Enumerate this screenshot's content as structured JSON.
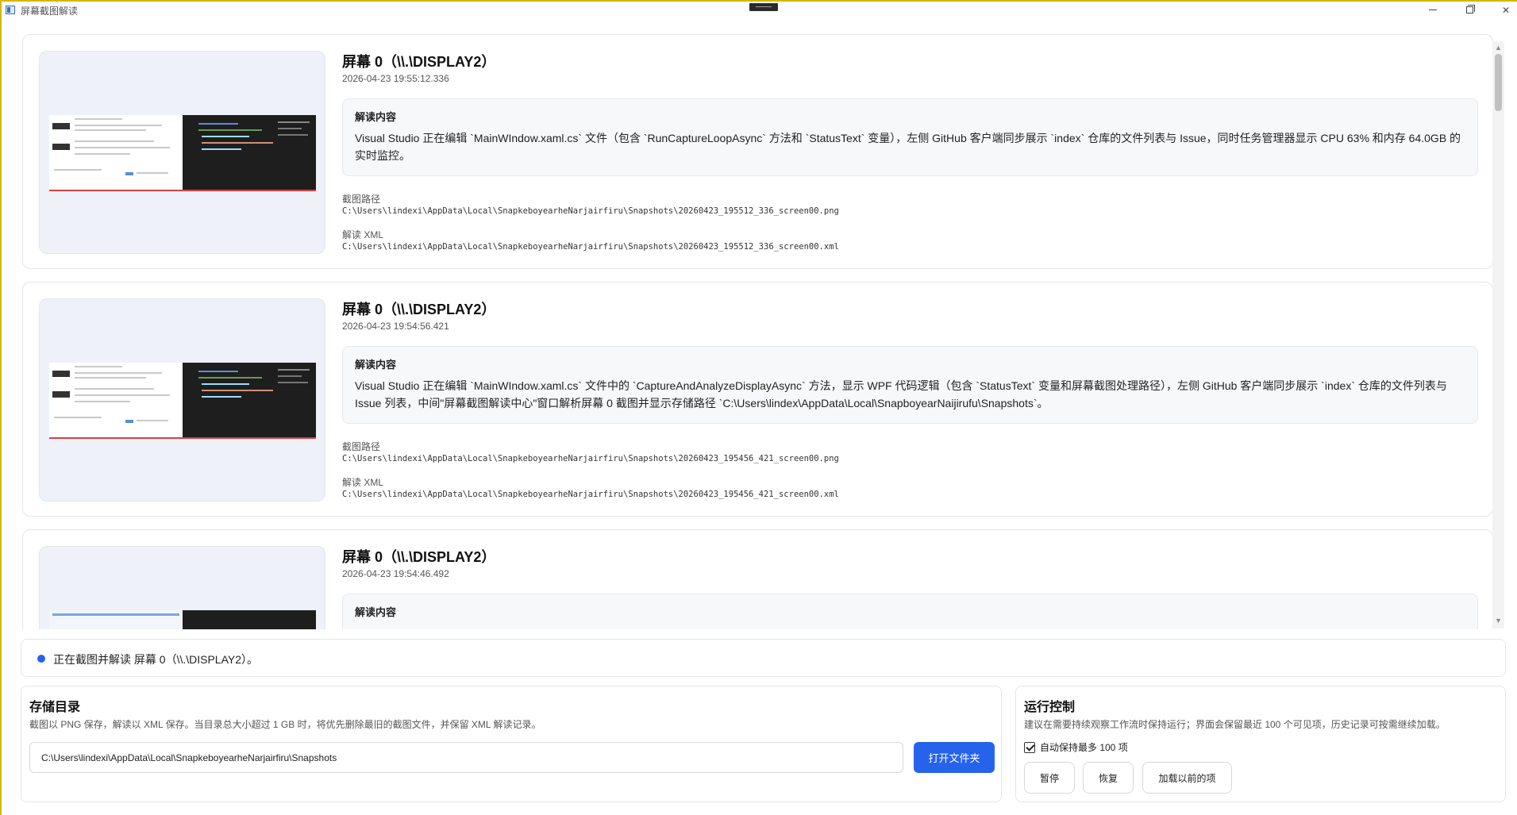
{
  "window": {
    "title": "屏幕截图解读"
  },
  "entries": [
    {
      "title": "屏幕 0（\\\\.\\DISPLAY2）",
      "timestamp": "2026-04-23 19:55:12.336",
      "analysis_label": "解读内容",
      "analysis_text": "Visual Studio 正在编辑 `MainWIndow.xaml.cs` 文件（包含 `RunCaptureLoopAsync` 方法和 `StatusText` 变量），左侧 GitHub 客户端同步展示 `index` 仓库的文件列表与 Issue，同时任务管理器显示 CPU 63% 和内存 64.0GB 的实时监控。",
      "screenshot_path_label": "截图路径",
      "screenshot_path": "C:\\Users\\lindexi\\AppData\\Local\\SnapkeboyearheNarjairfiru\\Snapshots\\20260423_195512_336_screen00.png",
      "xml_path_label": "解读 XML",
      "xml_path": "C:\\Users\\lindexi\\AppData\\Local\\SnapkeboyearheNarjairfiru\\Snapshots\\20260423_195512_336_screen00.xml"
    },
    {
      "title": "屏幕 0（\\\\.\\DISPLAY2）",
      "timestamp": "2026-04-23 19:54:56.421",
      "analysis_label": "解读内容",
      "analysis_text": "Visual Studio 正在编辑 `MainWIndow.xaml.cs` 文件中的 `CaptureAndAnalyzeDisplayAsync` 方法，显示 WPF 代码逻辑（包含 `StatusText` 变量和屏幕截图处理路径），左侧 GitHub 客户端同步展示 `index` 仓库的文件列表与 Issue 列表，中间\"屏幕截图解读中心\"窗口解析屏幕 0 截图并显示存储路径 `C:\\Users\\lindex\\AppData\\Local\\SnapboyearNaijirufu\\Snapshots`。",
      "screenshot_path_label": "截图路径",
      "screenshot_path": "C:\\Users\\lindexi\\AppData\\Local\\SnapkeboyearheNarjairfiru\\Snapshots\\20260423_195456_421_screen00.png",
      "xml_path_label": "解读 XML",
      "xml_path": "C:\\Users\\lindexi\\AppData\\Local\\SnapkeboyearheNarjairfiru\\Snapshots\\20260423_195456_421_screen00.xml"
    },
    {
      "title": "屏幕 0（\\\\.\\DISPLAY2）",
      "timestamp": "2026-04-23 19:54:46.492",
      "analysis_label": "解读内容"
    }
  ],
  "status": {
    "text": "正在截图并解读 屏幕 0（\\\\.\\DISPLAY2）。",
    "dot_color": "#2563eb"
  },
  "storage": {
    "title": "存储目录",
    "description": "截图以 PNG 保存，解读以 XML 保存。当目录总大小超过 1 GB 时，将优先删除最旧的截图文件，并保留 XML 解读记录。",
    "path_value": "C:\\Users\\lindexi\\AppData\\Local\\SnapkeboyearheNarjairfiru\\Snapshots",
    "open_folder_label": "打开文件夹"
  },
  "control": {
    "title": "运行控制",
    "description": "建议在需要持续观察工作流时保持运行；界面会保留最近 100 个可见项，历史记录可按需继续加载。",
    "auto_keep_label": "自动保持最多 100 项",
    "auto_keep_checked": true,
    "pause_label": "暂停",
    "resume_label": "恢复",
    "load_more_label": "加载以前的项"
  },
  "colors": {
    "accent": "#2563eb",
    "frame": "#d6b600"
  },
  "icons": {
    "app": "app-window-icon",
    "minimize": "minimize-icon",
    "maximize": "maximize-icon",
    "close": "close-icon",
    "scroll_up": "chevron-up-icon",
    "scroll_down": "chevron-down-icon"
  }
}
